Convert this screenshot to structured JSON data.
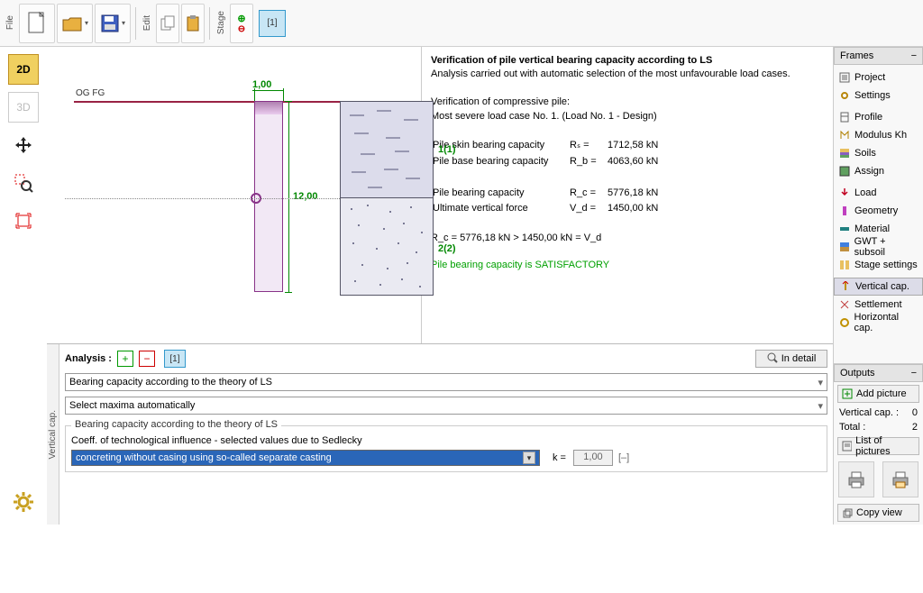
{
  "toolbar": {
    "file": "File",
    "edit": "Edit",
    "stage": "Stage",
    "stage_btn": "[1]"
  },
  "left": {
    "view2d": "2D",
    "view3d": "3D"
  },
  "viewport": {
    "og_label": "OG FG",
    "dim_top": "1,00",
    "dim_side": "12,00",
    "soil1": "1(1)",
    "soil2": "2(2)"
  },
  "results": {
    "title": "Verification of pile vertical bearing capacity according to LS",
    "sub": "Analysis carried out with automatic selection of the most unfavourable load cases.",
    "verif": "Verification of compressive pile:",
    "case": "Most severe load case No. 1. (Load No. 1 - Design)",
    "rs_lbl": "Pile skin bearing capacity",
    "rs_sym": "Rₛ  =",
    "rs_val": "1712,58 kN",
    "rb_lbl": "Pile base bearing capacity",
    "rb_sym": "R_b =",
    "rb_val": "4063,60 kN",
    "rc_lbl": "Pile bearing capacity",
    "rc_sym": "R_c  =",
    "rc_val": "5776,18 kN",
    "vd_lbl": "Ultimate vertical force",
    "vd_sym": "V_d  =",
    "vd_val": "1450,00 kN",
    "compare": "R_c = 5776,18 kN > 1450,00 kN = V_d",
    "ok": "Pile bearing capacity is SATISFACTORY"
  },
  "analysis": {
    "label": "Analysis :",
    "num": "[1]",
    "detail": "In detail",
    "sel1": "Bearing capacity according to the theory of LS",
    "sel2": "Select maxima automatically",
    "group_title": "Bearing capacity according to the theory of LS",
    "coeff_lbl": "Coeff. of technological influence - selected values due to Sedlecky",
    "dd_val": "concreting without casing using so-called separate casting",
    "k_lbl": "k =",
    "k_val": "1,00",
    "k_unit": "[–]"
  },
  "bottom_tab": "Vertical cap.",
  "frames": {
    "title": "Frames",
    "items": [
      "Project",
      "Settings",
      "Profile",
      "Modulus Kh",
      "Soils",
      "Assign",
      "Load",
      "Geometry",
      "Material",
      "GWT + subsoil",
      "Stage settings",
      "Vertical cap.",
      "Settlement",
      "Horizontal cap."
    ]
  },
  "outputs": {
    "title": "Outputs",
    "add": "Add picture",
    "l1_lbl": "Vertical cap. :",
    "l1_val": "0",
    "l2_lbl": "Total :",
    "l2_val": "2",
    "list": "List of pictures",
    "copy": "Copy view"
  }
}
